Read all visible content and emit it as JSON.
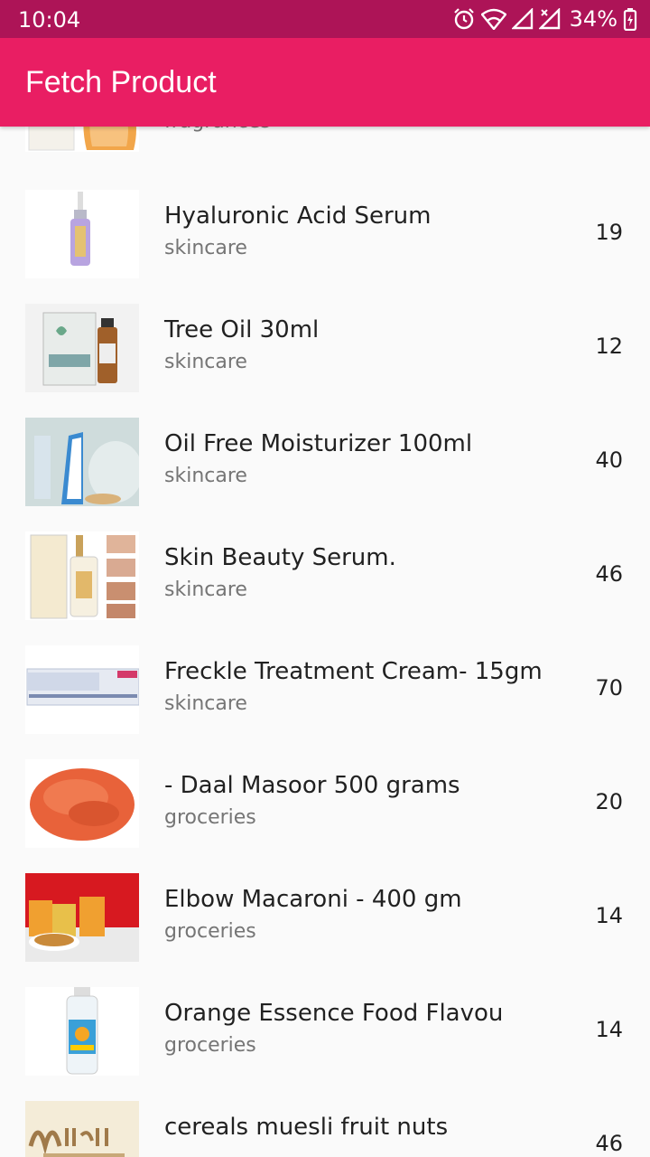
{
  "status_bar": {
    "time": "10:04",
    "battery": "34%",
    "icons": [
      "alarm-icon",
      "wifi-icon",
      "signal-icon",
      "signal-x-icon",
      "battery-charging-icon"
    ]
  },
  "app_bar": {
    "title": "Fetch Product"
  },
  "colors": {
    "status_bar": "#ad1457",
    "app_bar": "#e91e63",
    "background": "#fafafa"
  },
  "products": [
    {
      "name": "",
      "category": "fragrances",
      "price": "",
      "image": "perfume-bottle"
    },
    {
      "name": "Hyaluronic Acid Serum",
      "category": "skincare",
      "price": "19",
      "image": "serum-dropper"
    },
    {
      "name": "Tree Oil 30ml",
      "category": "skincare",
      "price": "12",
      "image": "tree-oil-box"
    },
    {
      "name": "Oil Free Moisturizer 100ml",
      "category": "skincare",
      "price": "40",
      "image": "moisturizer-tube"
    },
    {
      "name": "Skin Beauty Serum.",
      "category": "skincare",
      "price": "46",
      "image": "beauty-serum"
    },
    {
      "name": "Freckle Treatment Cream- 15gm",
      "category": "skincare",
      "price": "70",
      "image": "cream-box"
    },
    {
      "name": "- Daal Masoor 500 grams",
      "category": "groceries",
      "price": "20",
      "image": "lentils"
    },
    {
      "name": "Elbow Macaroni - 400 gm",
      "category": "groceries",
      "price": "14",
      "image": "macaroni"
    },
    {
      "name": "Orange Essence Food Flavou",
      "category": "groceries",
      "price": "14",
      "image": "essence-bottle"
    },
    {
      "name": "cereals muesli fruit nuts",
      "category": "",
      "price": "46",
      "image": "muesli"
    }
  ]
}
